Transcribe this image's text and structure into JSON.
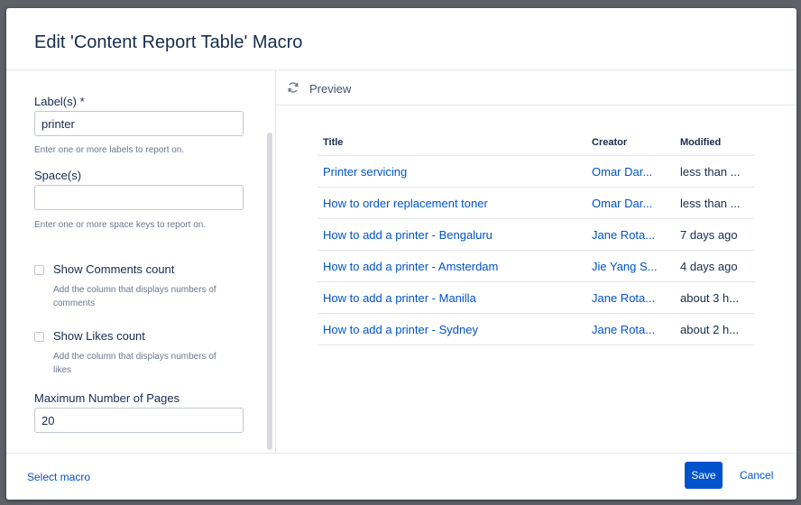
{
  "dialog": {
    "title": "Edit 'Content Report Table' Macro"
  },
  "form": {
    "labels": {
      "label": "Label(s) *",
      "value": "printer",
      "help": "Enter one or more labels to report on."
    },
    "spaces": {
      "label": "Space(s)",
      "value": "",
      "help": "Enter one or more space keys to report on."
    },
    "show_comments": {
      "label": "Show Comments count",
      "checked": false,
      "help": "Add the column that displays numbers of comments"
    },
    "show_likes": {
      "label": "Show Likes count",
      "checked": false,
      "help": "Add the column that displays numbers of likes"
    },
    "max_pages": {
      "label": "Maximum Number of Pages",
      "value": "20"
    }
  },
  "preview": {
    "label": "Preview",
    "columns": {
      "title": "Title",
      "creator": "Creator",
      "modified": "Modified"
    },
    "rows": [
      {
        "title": "Printer servicing",
        "creator": "Omar Dar...",
        "modified": "less than ..."
      },
      {
        "title": "How to order replacement toner",
        "creator": "Omar Dar...",
        "modified": "less than ..."
      },
      {
        "title": "How to add a printer - Bengaluru",
        "creator": "Jane Rota...",
        "modified": "7 days ago"
      },
      {
        "title": "How to add a printer - Amsterdam",
        "creator": "Jie Yang S...",
        "modified": "4 days ago"
      },
      {
        "title": "How to add a printer - Manilla",
        "creator": "Jane Rota...",
        "modified": "about 3 h..."
      },
      {
        "title": "How to add a printer - Sydney",
        "creator": "Jane Rota...",
        "modified": "about 2 h..."
      }
    ]
  },
  "footer": {
    "select_macro": "Select macro",
    "save": "Save",
    "cancel": "Cancel"
  },
  "colors": {
    "accent": "#0052cc",
    "text": "#172b4d",
    "muted": "#6b778c",
    "overlay": "#5e6168"
  },
  "icons": {
    "preview": "refresh-icon"
  }
}
